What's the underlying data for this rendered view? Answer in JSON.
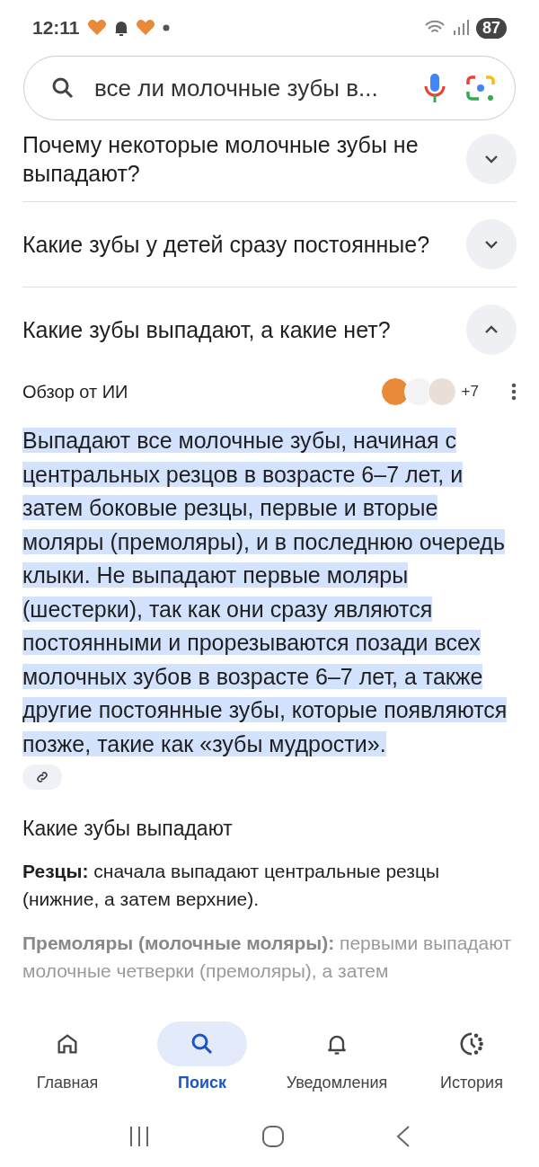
{
  "status_bar": {
    "time": "12:11",
    "battery": "87"
  },
  "search": {
    "value": "все ли молочные зубы в..."
  },
  "questions": [
    {
      "text": "Почему некоторые молочные зубы не выпадают?",
      "expanded": false
    },
    {
      "text": "Какие зубы у детей сразу постоянные?",
      "expanded": false
    },
    {
      "text": "Какие зубы выпадают, а какие нет?",
      "expanded": true
    }
  ],
  "ai_overview": {
    "title": "Обзор от ИИ",
    "sources_more": "+7",
    "answer": " Выпадают все молочные зубы, начиная с центральных резцов в возрасте 6–7 лет, и затем боковые резцы, первые и вторые моляры (премоляры), и в последнюю очередь клыки.  Не выпадают первые моляры (шестерки), так как они сразу являются постоянными и прорезываются позади всех молочных зубов в возрасте 6–7 лет, а также другие постоянные зубы, которые появляются позже, такие как «зубы мудрости».",
    "subheading": "Какие зубы выпадают",
    "points": [
      {
        "text": "**Резцы:** сначала выпадают центральные резцы (нижние, а затем верхние).",
        "faded": false
      },
      {
        "text": "**Премоляры (молочные моляры):** первыми выпадают молочные четверки (премоляры), а затем",
        "faded": true
      }
    ]
  },
  "nav": [
    {
      "label": "Главная",
      "selected": false
    },
    {
      "label": "Поиск",
      "selected": true
    },
    {
      "label": "Уведомления",
      "selected": false
    },
    {
      "label": "История",
      "selected": false
    }
  ]
}
